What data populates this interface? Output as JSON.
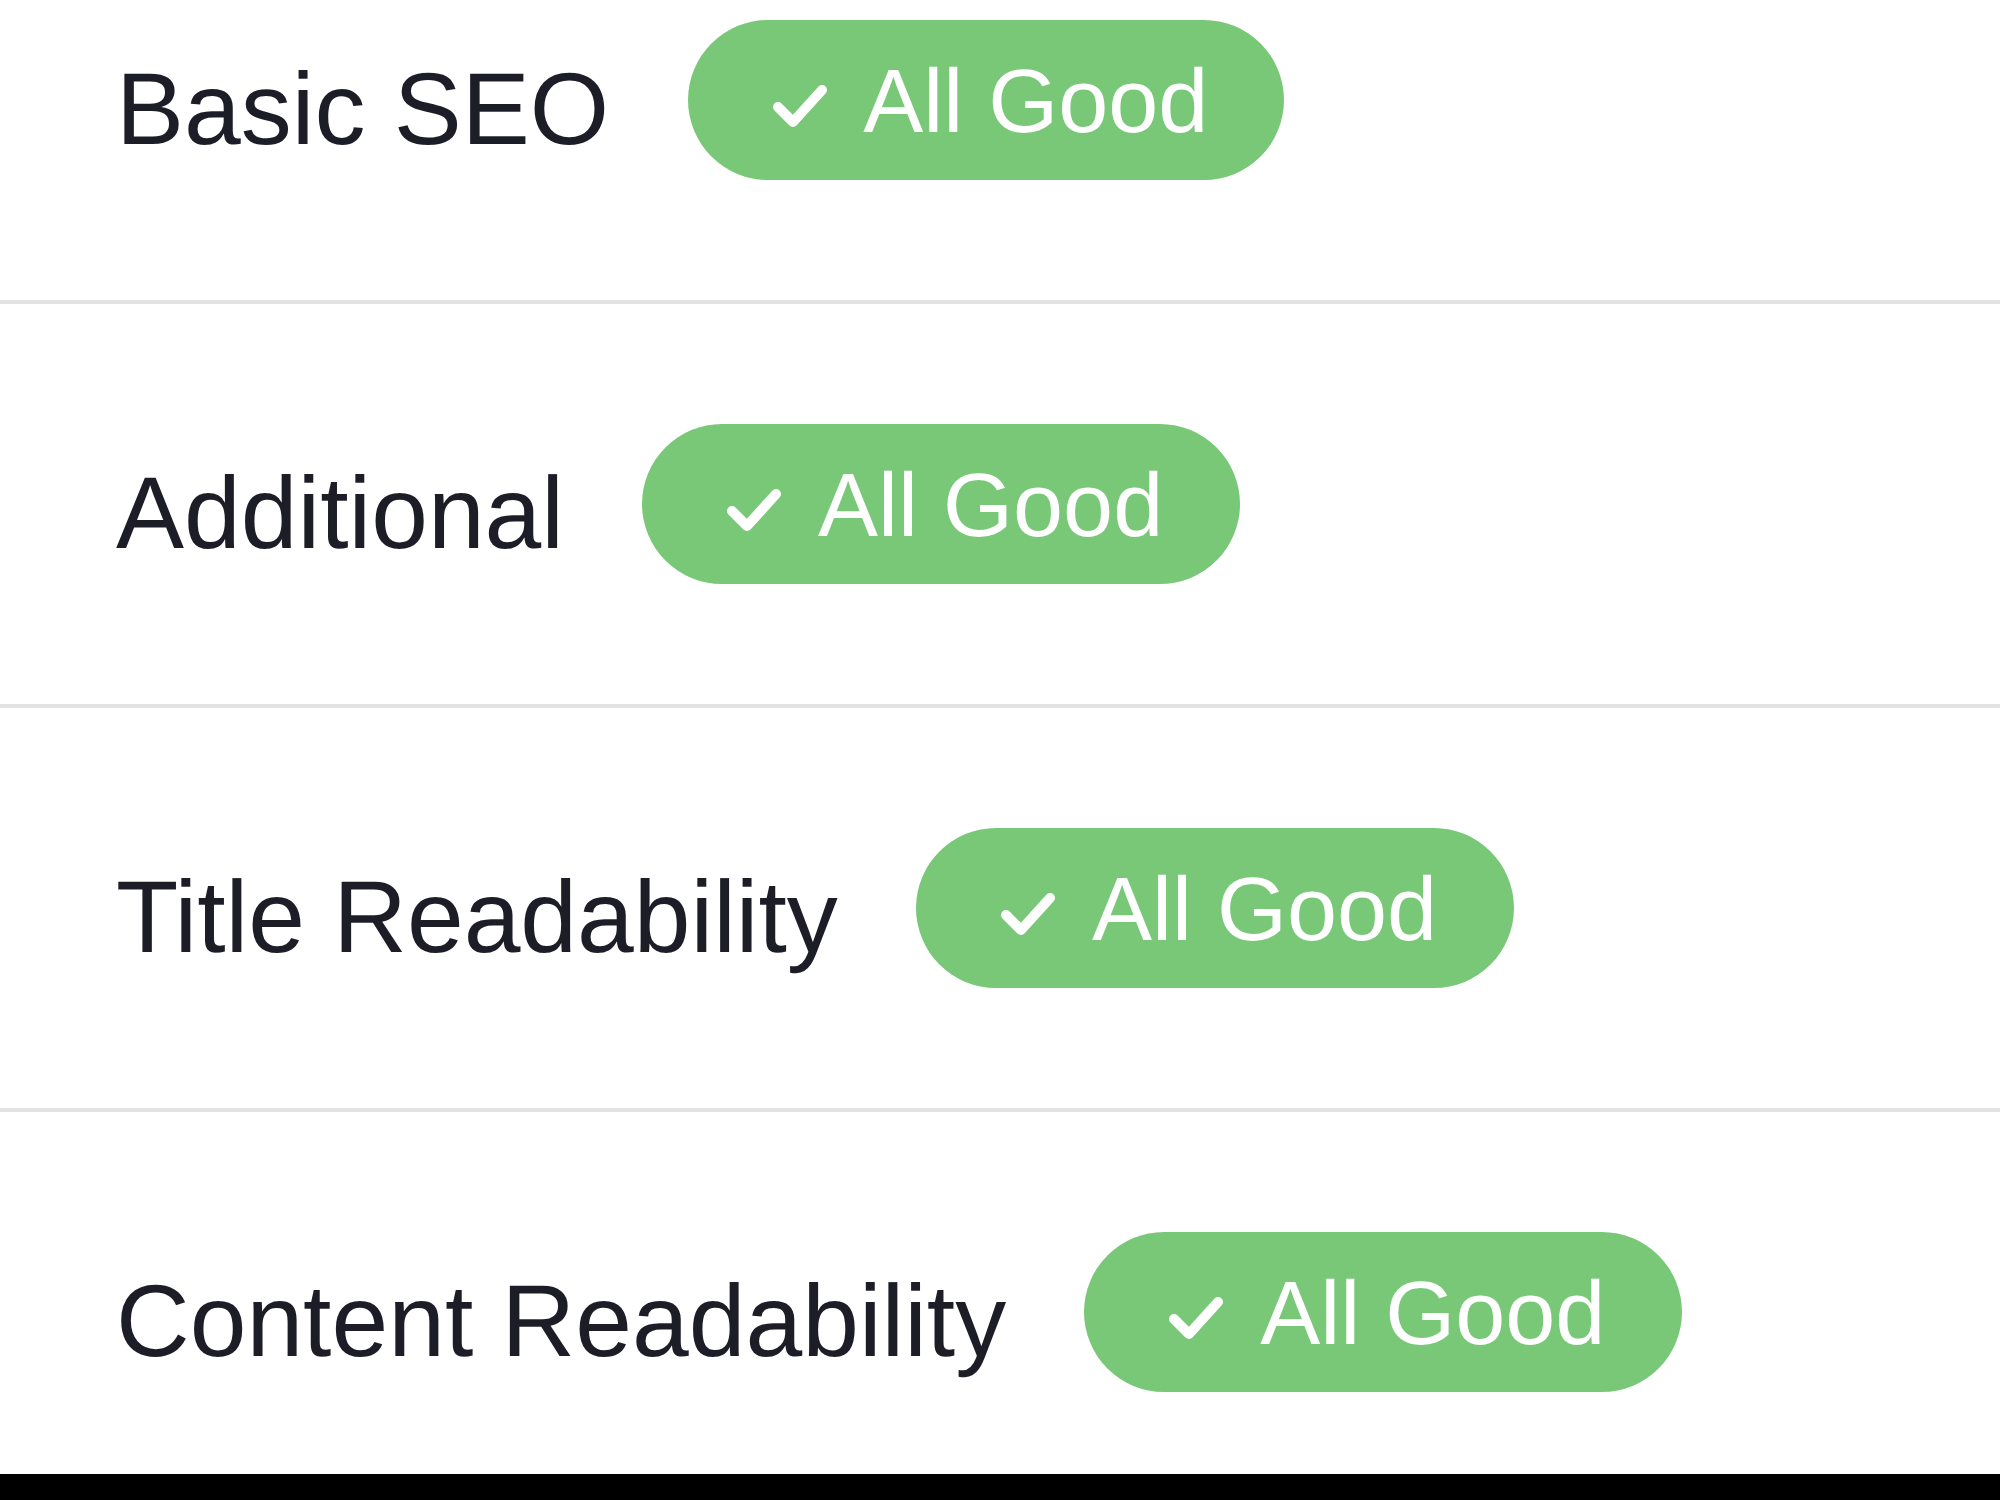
{
  "sections": [
    {
      "title": "Basic SEO",
      "badge": {
        "label": "All Good",
        "passed": true
      }
    },
    {
      "title": "Additional",
      "badge": {
        "label": "All Good",
        "passed": true
      }
    },
    {
      "title": "Title Readability",
      "badge": {
        "label": "All Good",
        "passed": true
      }
    },
    {
      "title": "Content Readability",
      "badge": {
        "label": "All Good",
        "passed": true
      }
    }
  ]
}
